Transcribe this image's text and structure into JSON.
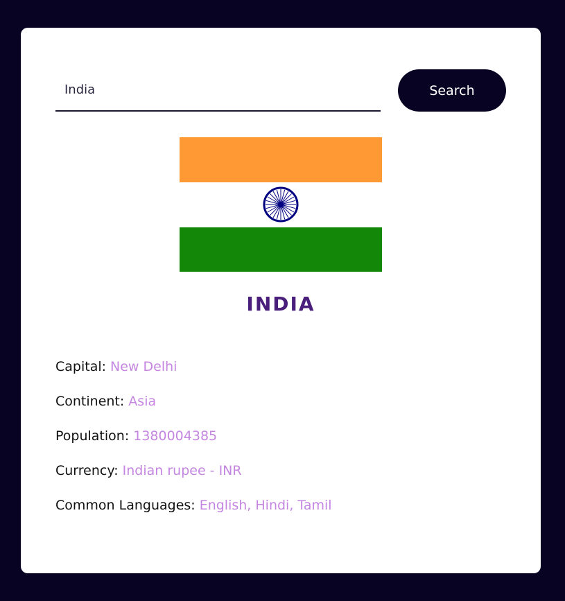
{
  "search": {
    "value": "India",
    "button_label": "Search"
  },
  "flag": {
    "colors": {
      "saffron": "#ff9933",
      "white": "#ffffff",
      "green": "#138808",
      "chakra": "#000080"
    },
    "icon": "india-flag-icon"
  },
  "country": {
    "name": "INDIA",
    "name_color": "#4a1f7c"
  },
  "value_color": "#c486e0",
  "facts": [
    {
      "label": "Capital:",
      "value": "New Delhi"
    },
    {
      "label": "Continent:",
      "value": "Asia"
    },
    {
      "label": "Population:",
      "value": "1380004385"
    },
    {
      "label": "Currency:",
      "value": "Indian rupee - INR"
    },
    {
      "label": "Common Languages:",
      "value": "English, Hindi, Tamil"
    }
  ]
}
